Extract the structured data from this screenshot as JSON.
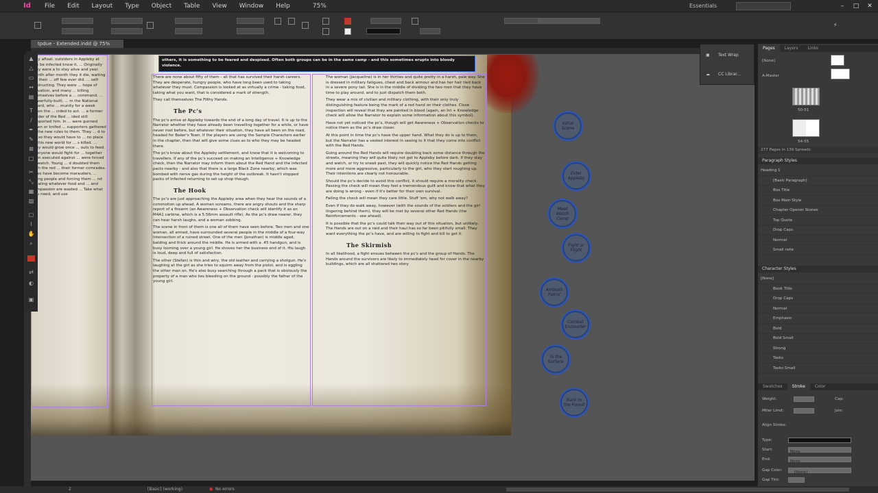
{
  "app": {
    "logo": "Id"
  },
  "menu": [
    "File",
    "Edit",
    "Layout",
    "Type",
    "Object",
    "Table",
    "View",
    "Window",
    "Help"
  ],
  "zoom": "75%",
  "workspace": "Essentials",
  "document_tab": "tpdue - Extended.indd @ 75%",
  "header_text": "others, it is something to be feared and despised. Often both groups can be in the same camp - and this sometimes erupts into bloody violence.",
  "left_fragment": {
    "text": "stay afloat. outsiders in Appleby at the be infected know it. ... Originally they were a to stay alive and year. Month after month they it die, waiting for their ... off few ever did. ... self-destructing. They were ... hope of salvation, and many ... killing themselves before a ... command. ... powerfully-built, ... m the National Guard, who ... munity for a week when the ... cided to act. ... e former leader of the Red ... ided still supported him. In ... were gunned down or knifed ... supporters gathered ... the new rules to them. They ... d to do so they would have to ... no place in this new world for ... s killed. ... they would grow once ... outs to feed. Everyone would fight for ... together then executed against ... were forced to watch. Young ... d doubted them with the red ... their former comrades. ... es have become marauders, ... aking people and forcing them ... nd stealing whatever food and ... and compassion are wasted ... Take what you need, and use"
  },
  "col1": {
    "p1": "There are none about fifty of them - all that has survived their harsh careers. They are desperate, hungry people, who have long been used to taking whatever they must. Compassion is looked at as virtually a crime - taking food, taking what you want, that is considered a mark of strength.",
    "p2": "They call themselves The Filthy Hands.",
    "h1": "The Pc's",
    "p3": "The pc's arrive at Appleby towards the end of a long day of travel. It is up to the Narrator whether they have already been travelling together for a while, or have never met before, but whatever their situation, they have all been on the road, headed for Baker's Town. If the players are using the Sample Characters earlier in the chapter, then that will give some clues as to who they may be headed there.",
    "p4": "The pc's know about the Appleby settlement, and know that it is welcoming to travellers. If any of the pc's succeed on making an Intelligence + Knowledge check, then the Narrator may inform them about the Red Hand and the infected pacts nearby - and also that there is a large Black Zone nearby, which was bombed with nerve gas during the height of the outbreak. It hasn't stopped packs of Infected returning to set up shop though.",
    "h2": "The Hook",
    "p5": "The pc's are just approaching the Appleby area when they hear the sounds of a commotion up ahead. A woman screams, there are angry shouts and the sharp report of a firearm (an Awareness + Observation check will identify it as an M4A1 carbine, which is a 5.56mm assault rifle). As the pc's draw nearer, they can hear harsh laughs, and a woman sobbing.",
    "p6": "The scene in front of them is one all of them have seen before. Two men and one woman, all armed, have surrounded several people in the middle of a four-way intersection of a ruined street. One of the men (Jonathan) is middle aged, balding and thick around the middle. He is armed with a .45 handgun, and is busy looming over a young girl. He shoves her the business end of it. His laugh is loud, deep and full of satisfaction.",
    "p7": "The other (Stefan) is thin and wiry, the old leather and carrying a shotgun. He's laughing at the girl as she tries to squirm away from the pistol, and is eggling the other man on. He's also busy searching through a pack that is obviously the property of a man who lies bleeding on the ground - possibly the father of the young girl."
  },
  "col2": {
    "p1": "The woman (Jacqueline) is in her thirties and quite pretty in a harsh, pale way. She is dressed in military fatigues, chest and back armour and has her hair tied back in a severe pony tail. She is in the middle of dividing the two men that they have time to play around, and to just dispatch them both.",
    "p2": "They wear a mix of civilian and military clothing, with their only truly distinguishing feature being the mark of a red hand on their clothes. Close inspection will reveal that they are painted in blood (again, an Int + Knowledge check will allow the Narrator to explain some information about this symbol).",
    "p3": "Have not yet noticed the pc's, though will get Awareness + Observation checks to notice them as the pc's draw closer.",
    "p4": "At this point in time the pc's have the upper hand. What they do is up to them, but the Narrator has a vested interest in seeing to it that they come into conflict with the Red Hands.",
    "p5": "Going around the Red Hands will require doubling back some distance through the streets, meaning they will quite likely not get to Appleby before dark. If they stay and watch, or try to sneak past, they will quickly notice the Red Hands getting more and more aggressive, particularly to the girl, who they start roughing up. Their intentions are clearly not honourable.",
    "p6": "Should the pc's decide to avoid this conflict, it should require a morality check. Passing the check will mean they feel a tremendous guilt and know that what they are doing is wrong - even if it's better for their own survival.",
    "p7": "Failing the check will mean they care little. Stuff 'em, why not walk away?",
    "p8": "Even if they do walk away, however (with the sounds of the soldiers and the girl lingering behind them), they will be met by several other Red Hands (the Reinforcements - see ahead).",
    "p9": "It is possible that the pc's could talk their way out of this situation, but unlikely. The Hands are out on a raid and their haul has so far been pitifully small. They want everything the pc's have, and are willing to fight and kill to get it.",
    "h1": "The Skirmish",
    "p10": "In all likelihood, a fight ensues between the pc's and the group of Hands. The Hands around the survivors are likely to immediately head for cover in the nearby buildings, which are all shattered two story"
  },
  "nodes": [
    "Initial Scene",
    "Enter Appleby",
    "Meet Watch Camp",
    "Fight or Flight",
    "Ambush Patrol",
    "Combat Encounter",
    "To the Surface",
    "Back to the Forest"
  ],
  "float_panel": {
    "text_wrap": "Text Wrap",
    "cc_libraries": "CC Librar..."
  },
  "pages_panel": {
    "tabs": [
      "Pages",
      "Layers",
      "Links"
    ],
    "none": "[None]",
    "master": "A-Master",
    "thumb1_label": "50-51",
    "thumb2_label": "54-55",
    "footer": "277 Pages in 139 Spreads"
  },
  "paragraph_styles": {
    "title": "Paragraph Styles",
    "current": "Heading 1",
    "items": [
      "[Basic Paragraph]",
      "Box Title",
      "Box Main Style",
      "Chapter Opener Stones",
      "Top Quote",
      "Drop Caps",
      "Normal",
      "Small note"
    ]
  },
  "character_styles": {
    "title": "Character Styles",
    "current": "[None]",
    "items": [
      "Book Title",
      "Drop Caps",
      "Normal",
      "Emphasis",
      "Bold",
      "Bold Small",
      "Strong",
      "Tasks",
      "Tasks Small"
    ]
  },
  "stroke_panel": {
    "tabs": [
      "Swatches",
      "Stroke",
      "Color"
    ],
    "weight": "Weight:",
    "miter": "Miter Limit:",
    "align": "Align Stroke:",
    "type": "Type:",
    "start": "Start:",
    "end": "End:",
    "gap_color": "Gap Color:",
    "gap_tint": "Gap Tint:",
    "none": "None",
    "none_bracket": "[None]",
    "cap": "Cap:",
    "join": "Join:"
  },
  "status": {
    "page": "2",
    "style": "[Basic] (working)",
    "errors": "No errors"
  }
}
